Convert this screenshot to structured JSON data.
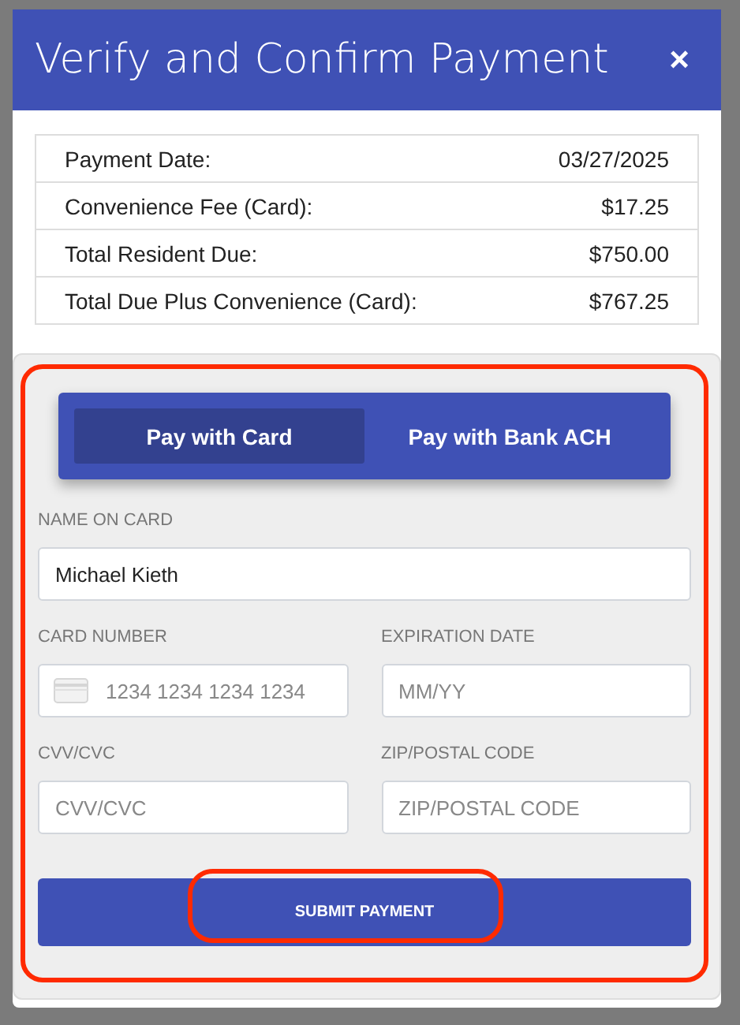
{
  "dialog": {
    "title": "Verify and Confirm Payment",
    "close": "×"
  },
  "summary": [
    {
      "label": "Payment Date:",
      "value": "03/27/2025"
    },
    {
      "label": "Convenience Fee (Card):",
      "value": "$17.25"
    },
    {
      "label": "Total Resident Due:",
      "value": "$750.00"
    },
    {
      "label": "Total Due Plus Convenience (Card):",
      "value": "$767.25"
    }
  ],
  "payment_tabs": [
    {
      "label": "Pay with Card",
      "selected": true
    },
    {
      "label": "Pay with Bank ACH",
      "selected": false
    }
  ],
  "fields": [
    {
      "label": "NAME ON CARD",
      "value": "Michael Kieth",
      "kind": "text",
      "full_width": true
    },
    {
      "label": "CARD NUMBER",
      "placeholder": "1234 1234 1234 1234",
      "kind": "card",
      "full_width": false
    },
    {
      "label": "EXPIRATION DATE",
      "placeholder": "MM/YY",
      "kind": "text",
      "full_width": false
    },
    {
      "label": "CVV/CVC",
      "placeholder": "CVV/CVC",
      "kind": "text",
      "full_width": false
    },
    {
      "label": "ZIP/POSTAL CODE",
      "placeholder": "ZIP/POSTAL CODE",
      "kind": "text",
      "full_width": false
    }
  ],
  "submit_button": "SUBMIT PAYMENT"
}
